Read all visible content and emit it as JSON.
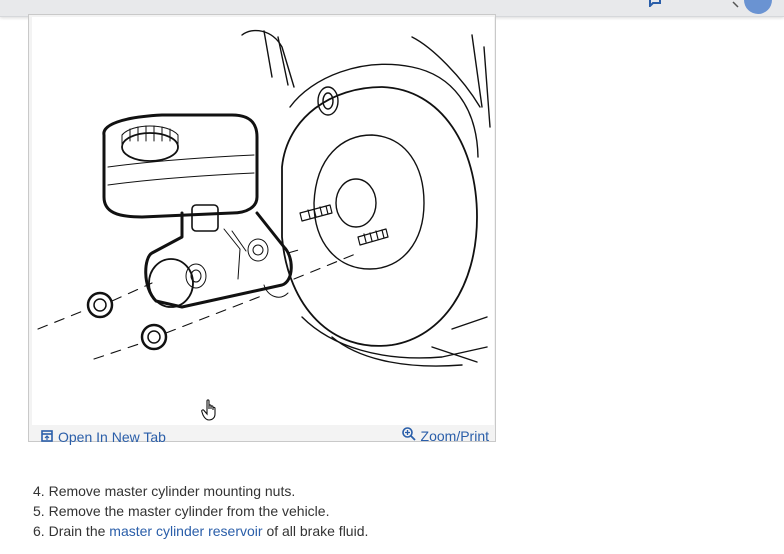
{
  "figure": {
    "open_tab_label": "Open In New Tab",
    "zoom_label": "Zoom/Print"
  },
  "steps": [
    {
      "number": "4.",
      "text": "Remove master cylinder mounting nuts."
    },
    {
      "number": "5.",
      "text": "Remove the master cylinder from the vehicle."
    },
    {
      "number": "6.",
      "before": "Drain the",
      "link": "master cylinder reservoir",
      "after": "of all brake fluid."
    }
  ],
  "colors": {
    "link": "#2a5ea9",
    "avatar": "#6a93d2",
    "topbar": "#e8e9eb"
  }
}
